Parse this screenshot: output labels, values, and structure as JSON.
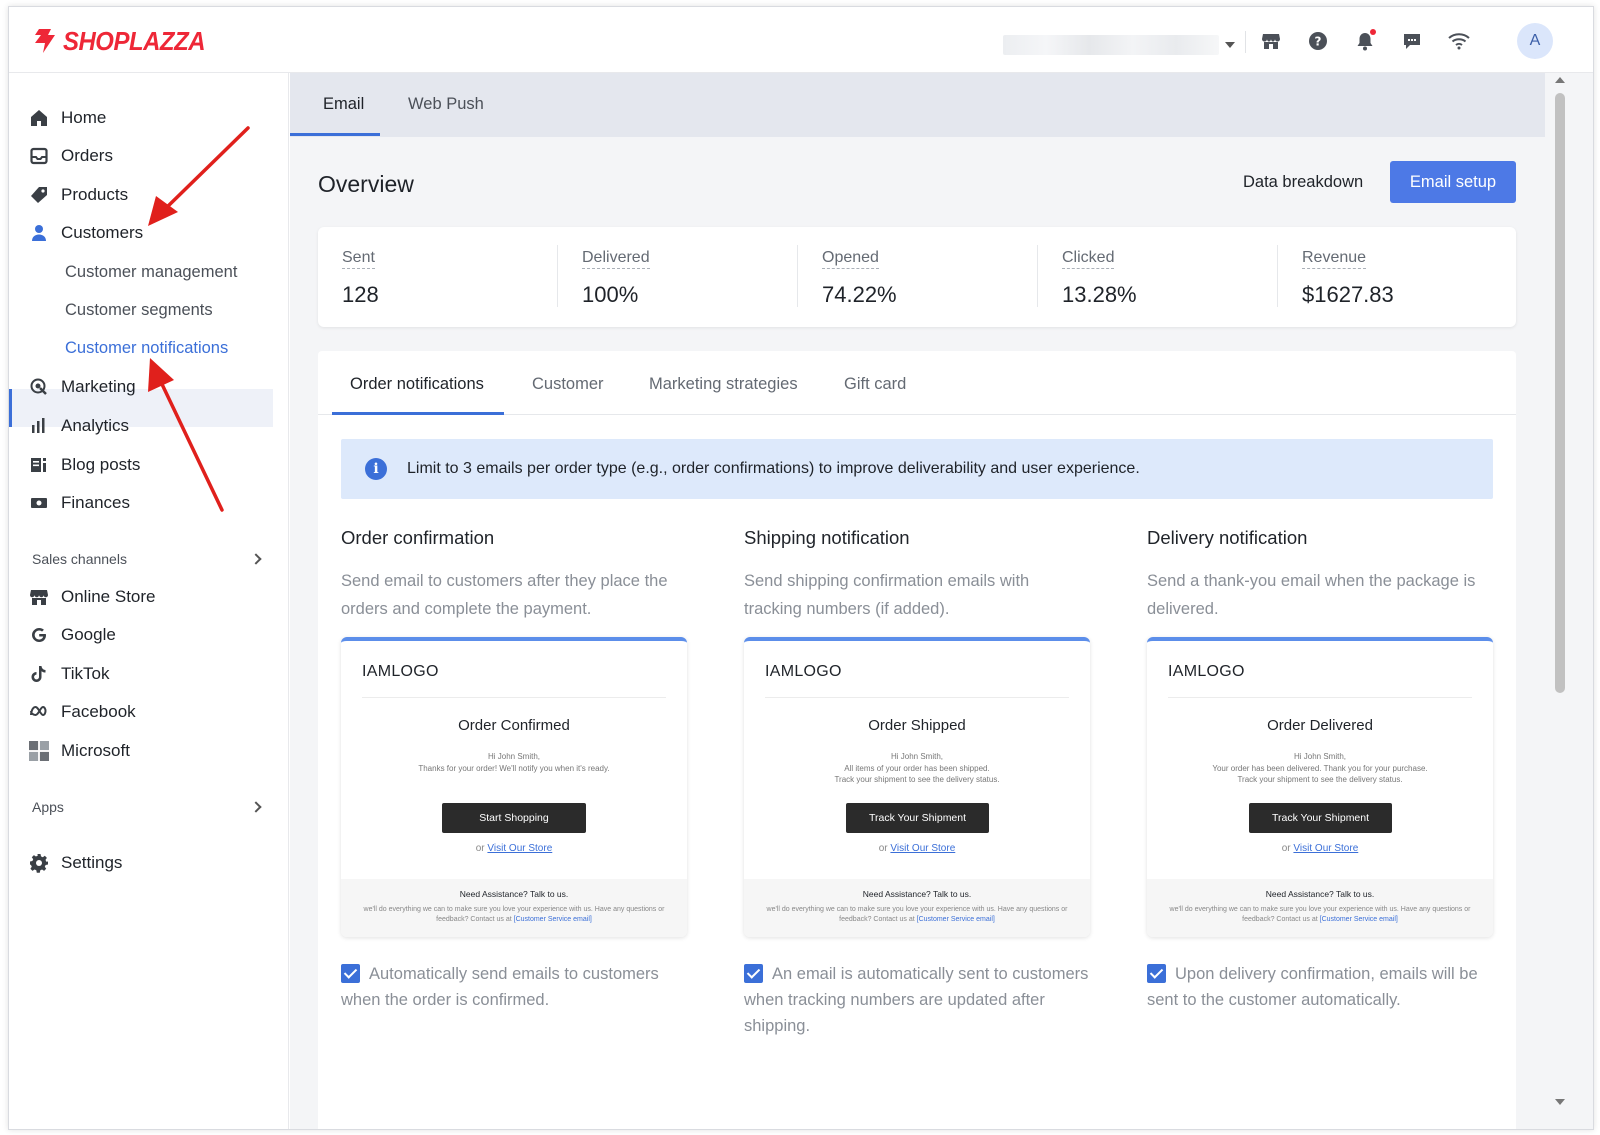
{
  "brand": {
    "name": "SHOPLAZZA",
    "color": "#ee2737"
  },
  "topbar": {
    "icons": [
      "store-icon",
      "help-icon",
      "bell-icon",
      "message-icon",
      "wifi-icon"
    ],
    "avatar_initial": "A"
  },
  "sidebar": {
    "items": [
      {
        "label": "Home",
        "icon": "home-icon"
      },
      {
        "label": "Orders",
        "icon": "orders-icon"
      },
      {
        "label": "Products",
        "icon": "tag-icon"
      },
      {
        "label": "Customers",
        "icon": "person-icon"
      },
      {
        "label": "Marketing",
        "icon": "marketing-icon"
      },
      {
        "label": "Analytics",
        "icon": "bar-chart-icon"
      },
      {
        "label": "Blog posts",
        "icon": "blog-icon"
      },
      {
        "label": "Finances",
        "icon": "finance-icon"
      }
    ],
    "customer_sub": [
      {
        "label": "Customer management"
      },
      {
        "label": "Customer segments"
      },
      {
        "label": "Customer notifications",
        "active": true
      }
    ],
    "sales_channels_label": "Sales channels",
    "channels": [
      {
        "label": "Online Store",
        "icon": "store-icon"
      },
      {
        "label": "Google",
        "icon": "google-icon"
      },
      {
        "label": "TikTok",
        "icon": "tiktok-icon"
      },
      {
        "label": "Facebook",
        "icon": "meta-icon"
      },
      {
        "label": "Microsoft",
        "icon": "microsoft-icon"
      }
    ],
    "apps_label": "Apps",
    "settings_label": "Settings"
  },
  "main": {
    "tabs": [
      {
        "label": "Email",
        "active": true
      },
      {
        "label": "Web Push"
      }
    ],
    "overview_title": "Overview",
    "data_breakdown_label": "Data breakdown",
    "email_setup_label": "Email setup",
    "accent_color": "#4d79e6",
    "stats": [
      {
        "label": "Sent",
        "value": "128"
      },
      {
        "label": "Delivered",
        "value": "100%"
      },
      {
        "label": "Opened",
        "value": "74.22%"
      },
      {
        "label": "Clicked",
        "value": "13.28%"
      },
      {
        "label": "Revenue",
        "value": "$1627.83"
      }
    ],
    "subtabs": [
      {
        "label": "Order notifications",
        "active": true
      },
      {
        "label": "Customer"
      },
      {
        "label": "Marketing strategies"
      },
      {
        "label": "Gift card"
      }
    ],
    "banner_text": "Limit to 3 emails per order type (e.g., order confirmations) to improve deliverability and user experience.",
    "notifications": [
      {
        "title": "Order confirmation",
        "desc_line1": "Send email to customers after they place the",
        "desc_line2": "orders and complete the payment.",
        "preview": {
          "logo": "IAMLOGO",
          "title": "Order Confirmed",
          "greeting": "Hi John Smith,",
          "body1": "Thanks for your order! We'll notify you when it's ready.",
          "body2": "",
          "button": "Start Shopping",
          "or": "or",
          "link": "Visit Our Store",
          "footer_title": "Need Assistance? Talk to us.",
          "footer_body": "we'll do everything we can to make sure you love your experience with us. Have any questions or feedback? Contact us at",
          "footer_link": "[Customer Service email]"
        },
        "checkbox_text": "Automatically send emails to customers when the order is confirmed."
      },
      {
        "title": "Shipping notification",
        "desc_line1": "Send shipping confirmation emails with",
        "desc_line2": "tracking numbers (if added).",
        "preview": {
          "logo": "IAMLOGO",
          "title": "Order Shipped",
          "greeting": "Hi John Smith,",
          "body1": "All items of your order has been shipped.",
          "body2": "Track your shipment to see the delivery status.",
          "button": "Track Your Shipment",
          "or": "or",
          "link": "Visit Our Store",
          "footer_title": "Need Assistance? Talk to us.",
          "footer_body": "we'll do everything we can to make sure you love your experience with us. Have any questions or feedback? Contact us at",
          "footer_link": "[Customer Service email]"
        },
        "checkbox_text": "An email is automatically sent to customers when tracking numbers are updated after shipping."
      },
      {
        "title": "Delivery notification",
        "desc_line1": "Send a thank-you email when the package is",
        "desc_line2": "delivered.",
        "preview": {
          "logo": "IAMLOGO",
          "title": "Order Delivered",
          "greeting": "Hi John Smith,",
          "body1": "Your order has been delivered. Thank you for your purchase.",
          "body2": "Track your shipment to see the delivery status.",
          "button": "Track Your Shipment",
          "or": "or",
          "link": "Visit Our Store",
          "footer_title": "Need Assistance? Talk to us.",
          "footer_body": "we'll do everything we can to make sure you love your experience with us. Have any questions or feedback? Contact us at",
          "footer_link": "[Customer Service email]"
        },
        "checkbox_text": "Upon delivery confirmation, emails will be sent to the customer automatically."
      }
    ]
  },
  "annotation_color": "#e0201c"
}
